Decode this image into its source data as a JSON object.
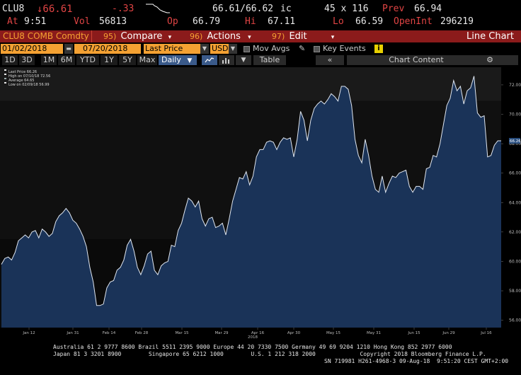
{
  "quote": {
    "ticker": "CLU8",
    "last": "↓66.61",
    "change": "-.33",
    "bid_ask": "66.61/66.62",
    "ic": "ic",
    "size": "45 x 116",
    "prev_label": "Prev",
    "prev": "66.94",
    "at_label": "At",
    "time": "9:51",
    "vol_label": "Vol",
    "vol": "56813",
    "op_label": "Op",
    "open": "66.79",
    "hi_label": "Hi",
    "high": "67.11",
    "lo_label": "Lo",
    "low": "66.59",
    "oi_label": "OpenInt",
    "open_int": "296219"
  },
  "menubar": {
    "security": "CLU8 COMB Comdty",
    "compare_num": "95)",
    "compare": "Compare",
    "actions_num": "96)",
    "actions": "Actions",
    "edit_num": "97)",
    "edit": "Edit",
    "view": "Line Chart"
  },
  "toolbar": {
    "start_date": "01/02/2018",
    "end_date": "07/20/2018",
    "field": "Last Price",
    "currency": "USD",
    "mov_avgs": "Mov Avgs",
    "key_events": "Key Events"
  },
  "rangebar": {
    "buttons": [
      "1D",
      "3D",
      "1M",
      "6M",
      "YTD",
      "1Y",
      "5Y",
      "Max"
    ],
    "period": "Daily",
    "table": "Table",
    "chart_content": "Chart Content"
  },
  "chart_data": {
    "type": "area",
    "legend": [
      "Last Price  66.26",
      "High on 07/10/18  72.56",
      "Average  64.65",
      "Low on 02/09/18  56.99"
    ],
    "x_tick_labels": [
      "Jan 12",
      "Jan 31",
      "Feb 14",
      "Feb 28",
      "Mar 15",
      "Mar 29",
      "Apr 16",
      "Apr 30",
      "May 15",
      "May 31",
      "Jun 15",
      "Jun 29",
      "Jul 16"
    ],
    "year_label": "2018",
    "y_ticks": [
      56,
      58,
      60,
      62,
      64,
      66,
      68,
      70,
      72
    ],
    "ylim": [
      55.5,
      73.2
    ],
    "last_value_tag": "66.26",
    "series": [
      {
        "values": [
          59.8,
          60.2,
          60.3,
          60.1,
          60.6,
          61.4,
          61.6,
          61.8,
          61.6,
          62.0,
          62.1,
          61.6,
          62.2,
          62.0,
          61.7,
          61.9,
          62.7,
          63.1,
          63.3,
          63.6,
          63.3,
          62.8,
          62.6,
          62.2,
          61.7,
          61.0,
          59.6,
          58.6,
          57.0,
          57.0,
          57.1,
          58.2,
          58.6,
          58.7,
          59.4,
          59.6,
          60.1,
          61.1,
          61.5,
          60.7,
          59.6,
          59.1,
          59.7,
          60.5,
          60.7,
          59.4,
          59.1,
          59.7,
          59.9,
          60.0,
          61.1,
          61.0,
          62.1,
          62.6,
          63.5,
          64.3,
          64.1,
          63.7,
          64.1,
          62.9,
          62.4,
          62.9,
          63.0,
          62.3,
          62.4,
          62.6,
          61.8,
          62.9,
          64.1,
          64.9,
          65.7,
          65.6,
          66.1,
          65.2,
          65.8,
          67.1,
          67.6,
          67.6,
          68.1,
          68.2,
          68.1,
          67.6,
          68.1,
          68.4,
          68.3,
          68.4,
          67.1,
          68.3,
          70.2,
          69.6,
          68.2,
          69.6,
          70.4,
          70.7,
          70.9,
          70.7,
          71.0,
          71.4,
          71.2,
          70.9,
          71.9,
          71.9,
          71.7,
          70.6,
          68.3,
          67.2,
          66.7,
          68.3,
          67.2,
          65.8,
          64.9,
          64.7,
          65.8,
          64.7,
          65.3,
          65.8,
          65.7,
          66.0,
          66.1,
          66.2,
          65.1,
          64.7,
          65.1,
          65.1,
          64.9,
          66.3,
          66.4,
          67.2,
          67.1,
          68.0,
          69.3,
          70.6,
          71.1,
          72.3,
          71.6,
          71.9,
          70.7,
          71.6,
          71.8,
          72.6,
          70.1,
          69.8,
          69.9,
          67.1,
          67.2,
          67.9,
          68.2,
          68.2
        ]
      }
    ]
  },
  "footer": {
    "line1": "Australia 61 2 9777 8600 Brazil 5511 2395 9000 Europe 44 20 7330 7500 Germany 49 69 9204 1210 Hong Kong 852 2977 6000",
    "line2": "Japan 81 3 3201 8900        Singapore 65 6212 1000        U.S. 1 212 318 2000             Copyright 2018 Bloomberg Finance L.P.",
    "line3": "SN 719981 H261-4968-3 09-Aug-18  9:51:20 CEST GMT+2:00"
  },
  "colors": {
    "accent": "#f4a132",
    "menubar": "#8b1b1b",
    "down": "#e04444",
    "area_fill": "#1a3358",
    "line": "#dfe6f0"
  },
  "icons": [
    "pencil-icon",
    "info-icon",
    "line-chart-icon",
    "bar-chart-icon",
    "double-chevron-left-icon",
    "gear-icon"
  ]
}
